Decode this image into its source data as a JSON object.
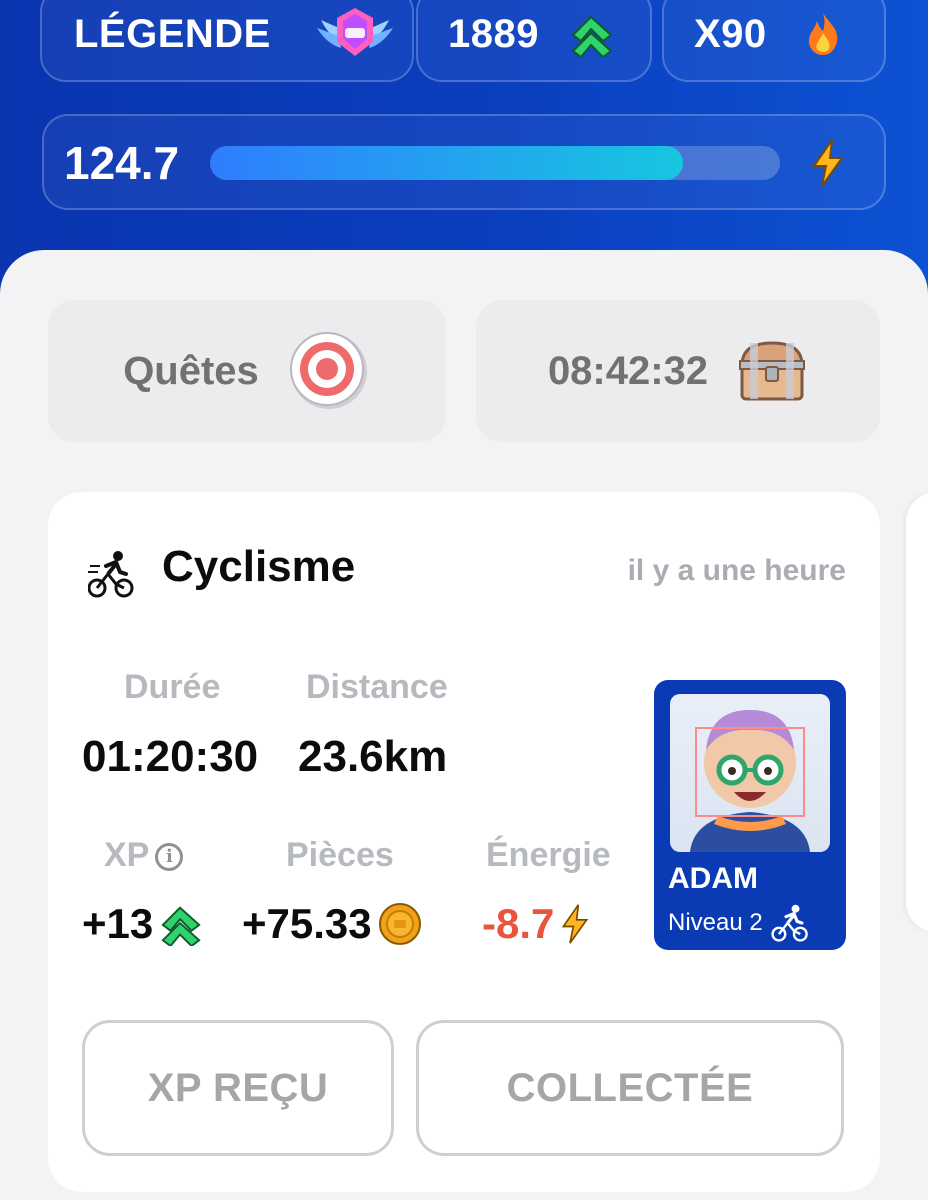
{
  "header": {
    "rank_label": "LÉGENDE",
    "xp_total": "1889",
    "streak": "X90",
    "energy_value": "124.7",
    "energy_fraction": 0.83
  },
  "tiles": {
    "quests_label": "Quêtes",
    "chest_timer": "08:42:32"
  },
  "activity": {
    "sport": "Cyclisme",
    "time_ago": "il y a une heure",
    "duration_label": "Durée",
    "duration_value": "01:20:30",
    "distance_label": "Distance",
    "distance_value": "23.6km",
    "xp_label": "XP",
    "xp_value": "+13",
    "coins_label": "Pièces",
    "coins_value": "+75.33",
    "energy_label": "Énergie",
    "energy_value": "-8.7"
  },
  "profile": {
    "name": "ADAM",
    "level": "Niveau 2"
  },
  "buttons": {
    "xp_received": "XP REÇU",
    "collected": "COLLECTÉE"
  },
  "colors": {
    "brand_blue": "#0a3bb4",
    "energy_negative": "#e8553b",
    "xp_green": "#2fd36b",
    "bar_start": "#2f7dff",
    "bar_end": "#17c6e0"
  },
  "icons": {
    "rank": "winged-badge-icon",
    "xp": "double-chevron-up-icon",
    "streak": "flame-icon",
    "energy": "lightning-icon",
    "quests": "target-icon",
    "chest": "treasure-chest-icon",
    "sport": "cyclist-icon",
    "info": "info-icon",
    "coin": "coin-icon"
  }
}
